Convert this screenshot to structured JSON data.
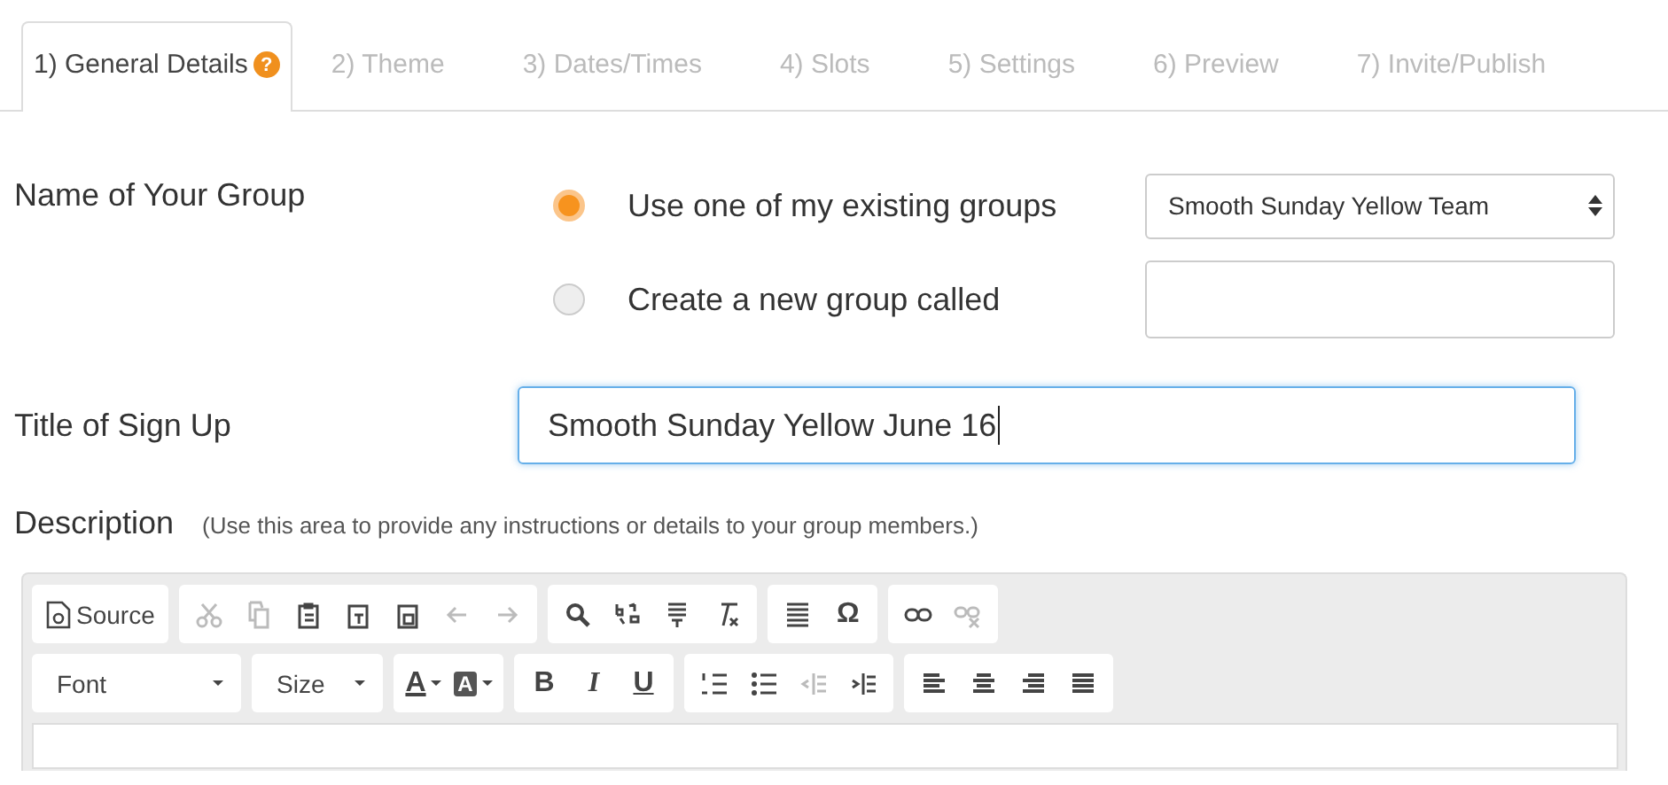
{
  "tabs": [
    {
      "label": "1) General Details",
      "selected": true,
      "badge": "?"
    },
    {
      "label": "2) Theme",
      "selected": false
    },
    {
      "label": "3) Dates/Times",
      "selected": false
    },
    {
      "label": "4) Slots",
      "selected": false
    },
    {
      "label": "5) Settings",
      "selected": false
    },
    {
      "label": "6) Preview",
      "selected": false
    },
    {
      "label": "7) Invite/Publish",
      "selected": false
    }
  ],
  "group": {
    "label": "Name of Your Group",
    "options": [
      {
        "label": "Use one of my existing groups",
        "selected": true
      },
      {
        "label": "Create a new group called",
        "selected": false
      }
    ],
    "select_value": "Smooth Sunday Yellow Team"
  },
  "title": {
    "label": "Title of Sign Up",
    "value": "Smooth Sunday Yellow June 16"
  },
  "description": {
    "label": "Description",
    "hint": "(Use this area to provide any instructions or details to your group members.)"
  },
  "editor": {
    "rows": [
      [
        [
          {
            "kind": "text",
            "label": "Source",
            "disabled": false
          }
        ],
        [
          {
            "kind": "icon",
            "disabled": true
          },
          {
            "kind": "icon",
            "disabled": true
          },
          {
            "kind": "icon",
            "disabled": false
          },
          {
            "kind": "icon",
            "disabled": false
          },
          {
            "kind": "icon",
            "disabled": false
          },
          {
            "kind": "icon",
            "disabled": true
          },
          {
            "kind": "icon",
            "disabled": true
          }
        ],
        [
          {
            "kind": "icon",
            "disabled": false
          },
          {
            "kind": "icon",
            "disabled": false
          },
          {
            "kind": "icon",
            "disabled": false
          },
          {
            "kind": "icon",
            "disabled": false
          }
        ],
        [
          {
            "kind": "icon",
            "disabled": false
          },
          {
            "kind": "glyph",
            "label": "Ω",
            "disabled": false
          }
        ],
        [
          {
            "kind": "icon",
            "disabled": false
          },
          {
            "kind": "icon",
            "disabled": true
          }
        ]
      ],
      [
        [
          {
            "kind": "combo",
            "label": "Font"
          }
        ],
        [
          {
            "kind": "combo",
            "label": "Size"
          }
        ],
        [
          {
            "kind": "color",
            "label": "A",
            "disabled": false
          },
          {
            "kind": "bgcolor",
            "label": "A",
            "disabled": false
          }
        ],
        [
          {
            "kind": "glyph",
            "label": "B",
            "disabled": false
          },
          {
            "kind": "glyph",
            "label": "I",
            "disabled": false
          },
          {
            "kind": "glyph",
            "label": "U",
            "disabled": false
          }
        ],
        [
          {
            "kind": "icon",
            "disabled": false
          },
          {
            "kind": "icon",
            "disabled": false
          },
          {
            "kind": "icon",
            "disabled": true
          },
          {
            "kind": "icon",
            "disabled": false
          }
        ],
        [
          {
            "kind": "icon",
            "disabled": false
          },
          {
            "kind": "icon",
            "disabled": false
          },
          {
            "kind": "icon",
            "disabled": false
          },
          {
            "kind": "icon",
            "disabled": false
          }
        ]
      ]
    ]
  }
}
